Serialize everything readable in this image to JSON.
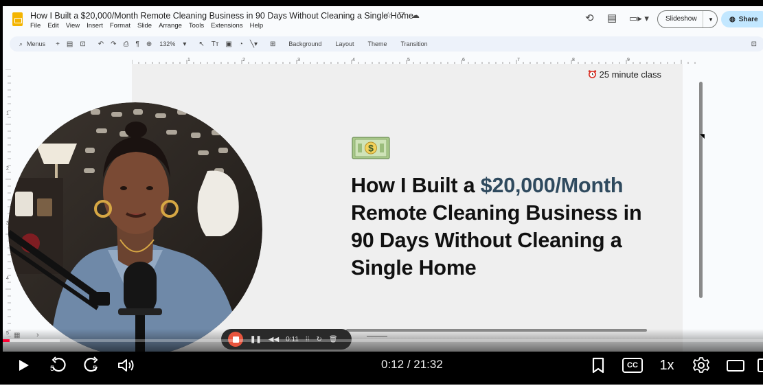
{
  "docs": {
    "title": "How I Built a $20,000/Month Remote Cleaning Business in 90 Days Without Cleaning a Single Home",
    "menu": [
      "File",
      "Edit",
      "View",
      "Insert",
      "Format",
      "Slide",
      "Arrange",
      "Tools",
      "Extensions",
      "Help"
    ],
    "slideshow_label": "Slideshow",
    "share_label": "Share",
    "toolbar": {
      "menus_label": "Menus",
      "zoom": "132%",
      "background": "Background",
      "layout": "Layout",
      "theme": "Theme",
      "transition": "Transition"
    },
    "ruler_numbers": [
      "1",
      "2",
      "3",
      "4",
      "5",
      "6",
      "7",
      "8",
      "9"
    ],
    "ruler_left_numbers": [
      "1",
      "2",
      "3",
      "4",
      "5"
    ]
  },
  "slide": {
    "badge_icon": "alarm-clock-icon",
    "badge": "25 minute class",
    "money_icon": "dollar-banknote-icon",
    "heading_line1_plain": "How I Built a ",
    "heading_line1_accent": "$20,000/Month",
    "heading_line2": "Remote Cleaning Business in",
    "heading_line3": "90 Days Without Cleaning a",
    "heading_line4": "Single Home",
    "accent_color": "#2f4a5e"
  },
  "recorder": {
    "elapsed": "0:11"
  },
  "player": {
    "current_time": "0:12",
    "separator": " / ",
    "duration": "21:32",
    "progress_fraction": 0.0093,
    "loaded_fraction": 0.075,
    "speed": "1x",
    "cc": "CC",
    "skip_seconds": "5",
    "progress_color": "#ff0033"
  }
}
